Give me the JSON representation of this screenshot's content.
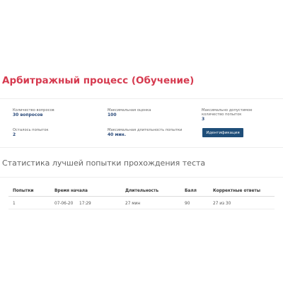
{
  "title": "Арбитражный процесс (Обучение)",
  "info": {
    "questions": {
      "label": "Количество вопросов",
      "value": "30 вопросов"
    },
    "max_score": {
      "label": "Максимальная оценка",
      "value": "100"
    },
    "max_attempts": {
      "label": "Максимально допустимое количество попыток",
      "value": "3"
    },
    "attempts_left": {
      "label": "Осталось попыток",
      "value": "2"
    },
    "max_duration": {
      "label": "Максимальная длительность попытки",
      "value": "40 мин."
    }
  },
  "buttons": {
    "identify": "Идентификация"
  },
  "stats": {
    "title": "Статистика лучшей попытки прохождения теста",
    "headers": [
      "Попытки",
      "Время начала",
      "Длительность",
      "Балл",
      "Корректные ответы"
    ],
    "rows": [
      [
        "1",
        "07-06-20",
        "17:29",
        "27 мин",
        "90",
        "27 из 30"
      ]
    ]
  }
}
